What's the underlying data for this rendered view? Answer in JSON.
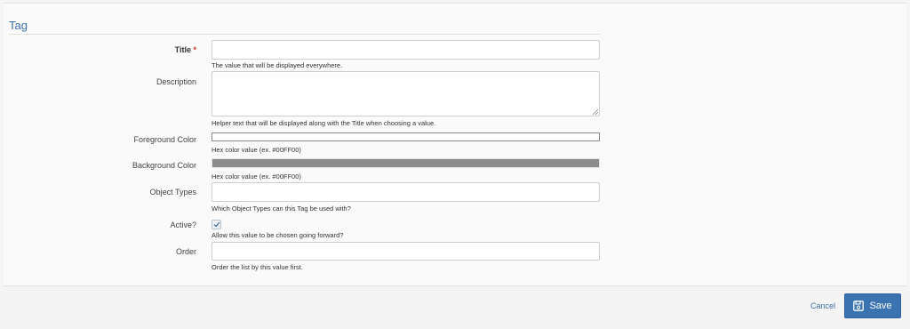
{
  "form": {
    "legend": "Tag",
    "fields": {
      "title": {
        "label": "Title",
        "required_mark": "*",
        "value": "",
        "help": "The value that will be displayed everywhere."
      },
      "description": {
        "label": "Description",
        "value": "",
        "help": "Helper text that will be displayed along with the Title when choosing a value."
      },
      "foreground_color": {
        "label": "Foreground Color",
        "value": "#FFFFFF",
        "help": "Hex color value (ex. #00FF00)"
      },
      "background_color": {
        "label": "Background Color",
        "value": "#8C8C8C",
        "help": "Hex color value (ex. #00FF00)"
      },
      "object_types": {
        "label": "Object Types",
        "value": "",
        "help": "Which Object Types can this Tag be used with?"
      },
      "active": {
        "label": "Active?",
        "checked": true,
        "help": "Allow this value to be chosen going forward?"
      },
      "order": {
        "label": "Order",
        "value": "",
        "help": "Order the list by this value first."
      }
    }
  },
  "footer": {
    "cancel_label": "Cancel",
    "save_label": "Save"
  },
  "colors": {
    "accent": "#3A73B0",
    "required": "#C9302C"
  },
  "icons": {
    "save": "floppy-disk-icon",
    "check": "checkmark-icon",
    "resize": "resize-handle-icon"
  }
}
